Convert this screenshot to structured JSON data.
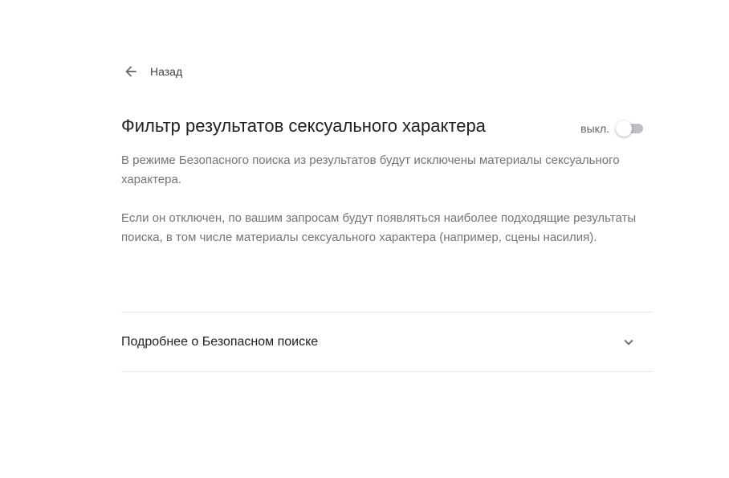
{
  "nav": {
    "back_label": "Назад"
  },
  "filter": {
    "title": "Фильтр результатов сексуального характера",
    "toggle_label": "выкл.",
    "toggle_on": false,
    "description_1": "В режиме Безопасного поиска из результатов будут исключены материалы сексуального характера.",
    "description_2": "Если он отключен, по вашим запросам будут появляться наиболее подходящие результаты поиска, в том числе материалы сексуального характера (например, сцены насилия)."
  },
  "more": {
    "label": "Подробнее о Безопасном поиске",
    "expanded": false
  },
  "colors": {
    "title": "#202124",
    "body_text": "#70757a",
    "toggle_track_off": "#bdc1c6",
    "divider": "#e8eaed"
  }
}
